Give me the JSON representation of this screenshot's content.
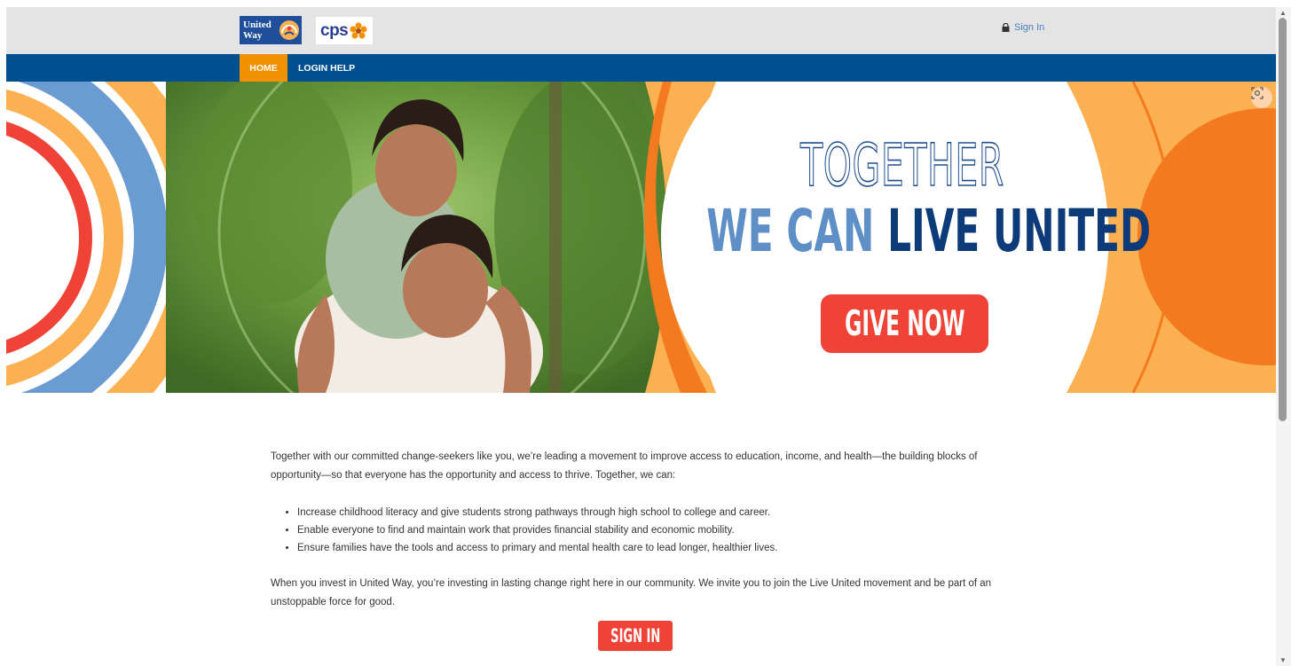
{
  "header": {
    "logo_united_way": "United Way",
    "logo_cps": "cps",
    "signin_label": "Sign In"
  },
  "nav": {
    "items": [
      {
        "label": "HOME",
        "active": true
      },
      {
        "label": "LOGIN HELP",
        "active": false
      }
    ]
  },
  "hero": {
    "line1": "TOGETHER",
    "line2_light": "WE CAN ",
    "line2_dark": "LIVE UNITED",
    "cta": "GIVE NOW"
  },
  "content": {
    "intro": "Together with our committed change-seekers like you, we’re leading a movement to improve access to education, income, and health—the building blocks of opportunity—so that everyone has the opportunity and access to thrive. Together, we can:",
    "bullets": [
      "Increase childhood literacy and give students strong pathways through high school to college and career.",
      "Enable everyone to find and maintain work that provides financial stability and economic mobility.",
      "Ensure families have the tools and access to primary and mental health care to lead longer, healthier lives."
    ],
    "closing": "When you invest in United Way, you’re investing in lasting change right here in our community. We invite you to join the Live United movement and be part of an unstoppable force for good.",
    "signin_button": "SIGN IN"
  },
  "colors": {
    "nav_bg": "#00508f",
    "nav_active": "#f39200",
    "cta_red": "#ef4337",
    "hero_orange": "#f47a20",
    "hero_light_orange": "#fbb052",
    "hero_blue": "#6a9bd1",
    "hero_red": "#ef4337"
  },
  "icons": [
    "lock-icon",
    "lens-icon",
    "scroll-up-icon",
    "scroll-down-icon"
  ]
}
